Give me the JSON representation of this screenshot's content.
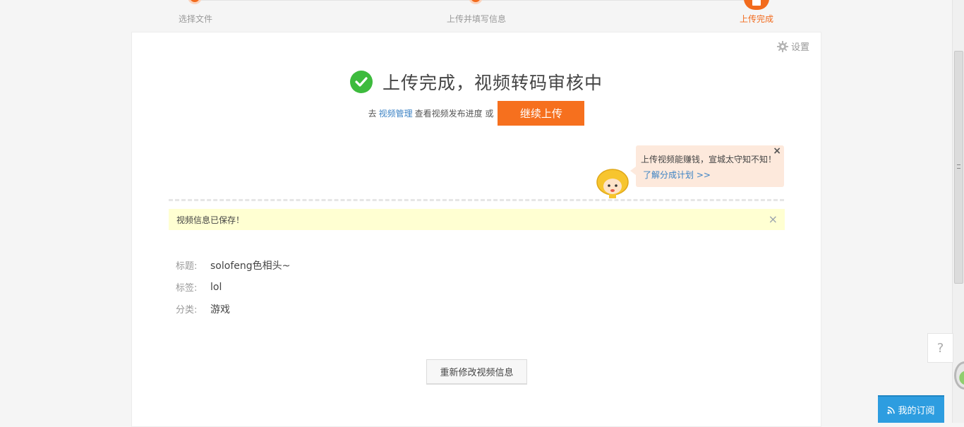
{
  "steps": [
    {
      "label": "选择文件",
      "state": "done"
    },
    {
      "label": "上传并填写信息",
      "state": "done"
    },
    {
      "label": "上传完成",
      "state": "active"
    }
  ],
  "settings": {
    "label": "设置",
    "icon": "gear-icon"
  },
  "result": {
    "title": "上传完成，视频转码审核中",
    "goto_prefix": "去",
    "manage_link": "视频管理",
    "goto_suffix": "查看视频发布进度 或",
    "continue_label": "继续上传",
    "icon": "check-circle-icon"
  },
  "tip_bubble": {
    "message": "上传视频能赚钱，宣城太守知不知！",
    "link": "了解分成计划 >>",
    "close": "×"
  },
  "notice": {
    "text": "视频信息已保存！",
    "close": "×"
  },
  "video_info": [
    {
      "key": "标题:",
      "value": "solofeng色相头~"
    },
    {
      "key": "标签:",
      "value": "lol"
    },
    {
      "key": "分类:",
      "value": "游戏"
    }
  ],
  "edit_button": "重新修改视频信息",
  "help": "?",
  "subscribe": {
    "label": "我的订阅",
    "icon": "rss-icon"
  },
  "colors": {
    "accent": "#f6701e",
    "success": "#3dbb3d",
    "link": "#3b82c4",
    "notice_bg": "#ffffd2"
  }
}
